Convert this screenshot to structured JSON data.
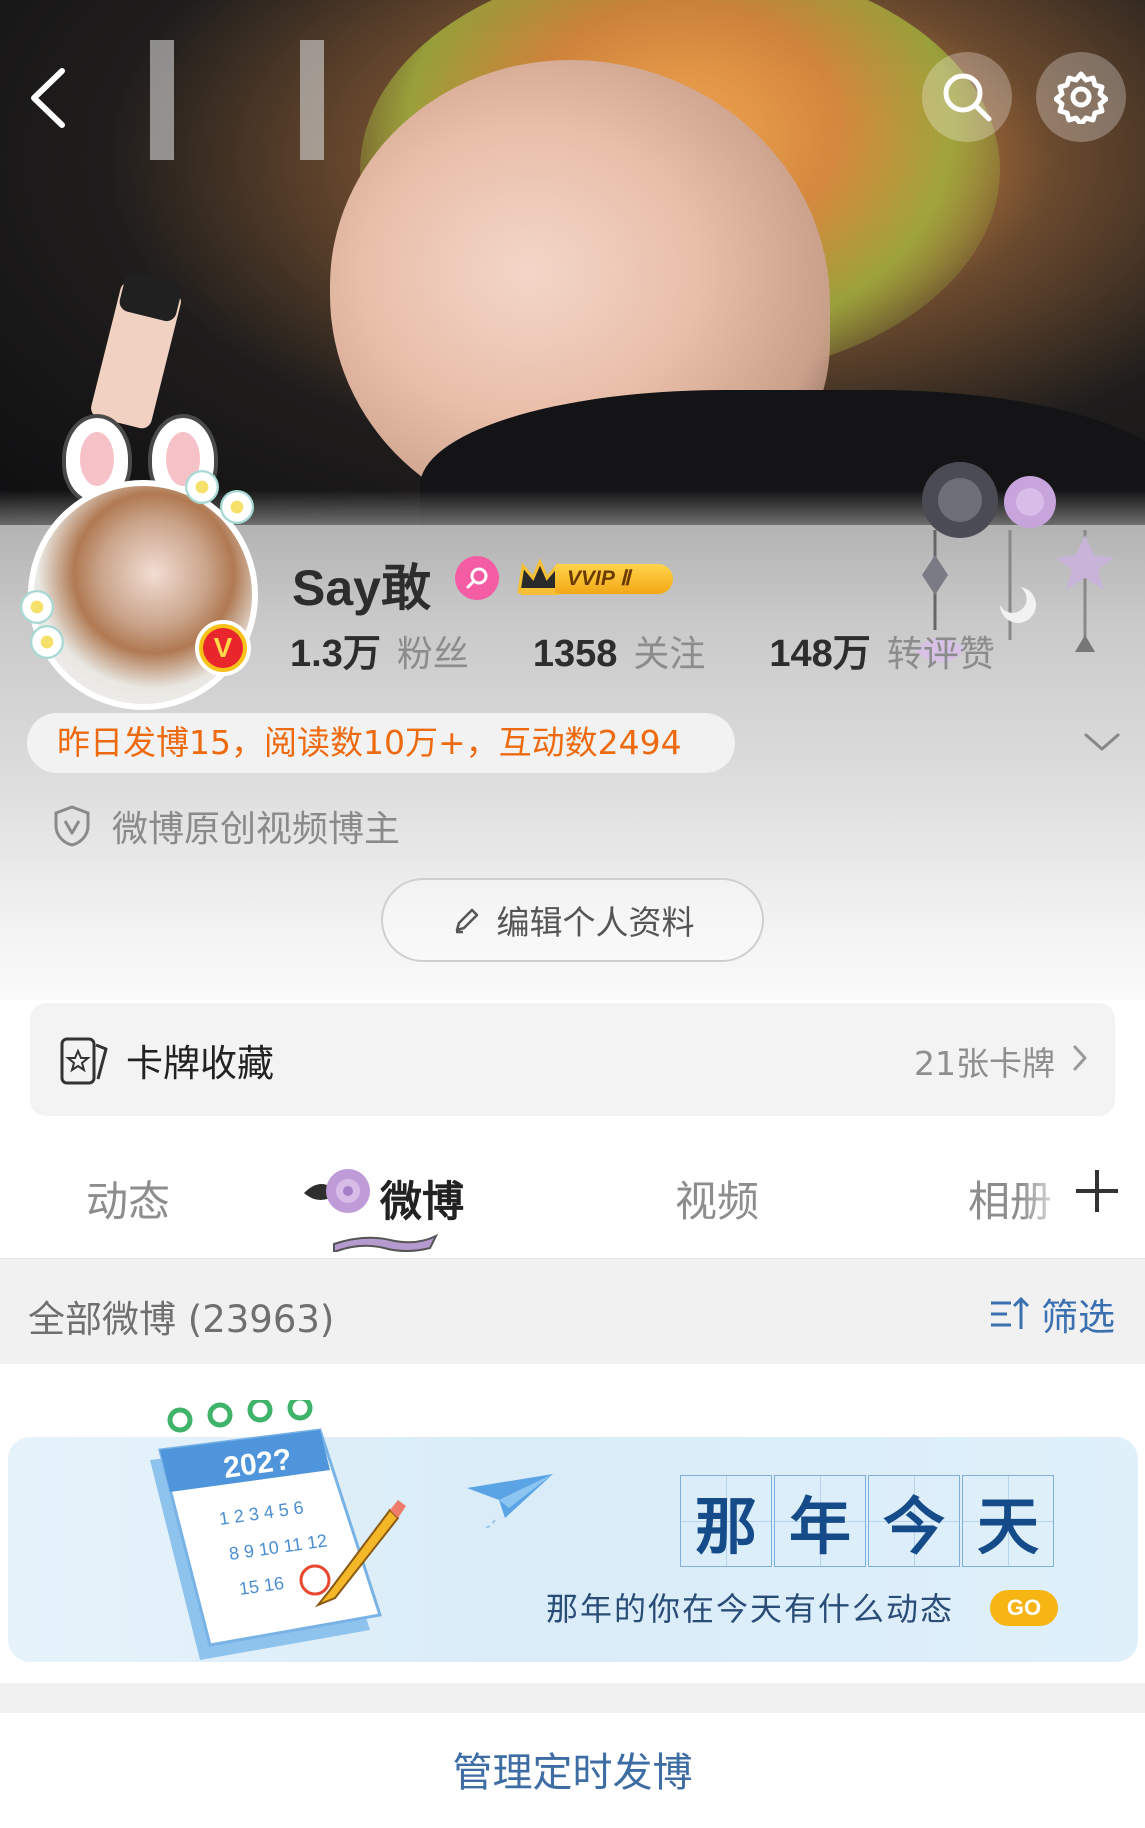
{
  "header": {
    "back_icon": "chevron-left-icon",
    "search_icon": "search-icon",
    "settings_icon": "gear-icon"
  },
  "profile": {
    "username": "Say敢",
    "vvip_label": "VVIP Ⅱ",
    "gender_icon": "female-icon",
    "stats": [
      {
        "value": "1.3万",
        "label": "粉丝"
      },
      {
        "value": "1358",
        "label": "关注"
      },
      {
        "value": "148万",
        "label": "转评赞"
      }
    ],
    "activity_summary": "昨日发博15，阅读数10万+，互动数2494",
    "verification": "微博原创视频博主",
    "edit_button": "编辑个人资料"
  },
  "cards": {
    "title": "卡牌收藏",
    "count": "21张卡牌"
  },
  "tabs": [
    {
      "label": "动态",
      "active": false
    },
    {
      "label": "微博",
      "active": true
    },
    {
      "label": "视频",
      "active": false
    },
    {
      "label": "相册",
      "active": false
    }
  ],
  "feed": {
    "all_label": "全部微博 (23963)",
    "filter_label": "筛选"
  },
  "banner": {
    "title_chars": [
      "那",
      "年",
      "今",
      "天"
    ],
    "subtitle": "那年的你在今天有什么动态",
    "go_label": "GO",
    "calendar_year": "202?"
  },
  "footer": {
    "manage_label": "管理定时发博"
  },
  "colors": {
    "accent_orange": "#ee6a0f",
    "link_blue": "#3e6da3",
    "vvip_gold": "#f3a817",
    "verified_red": "#e8262c"
  }
}
